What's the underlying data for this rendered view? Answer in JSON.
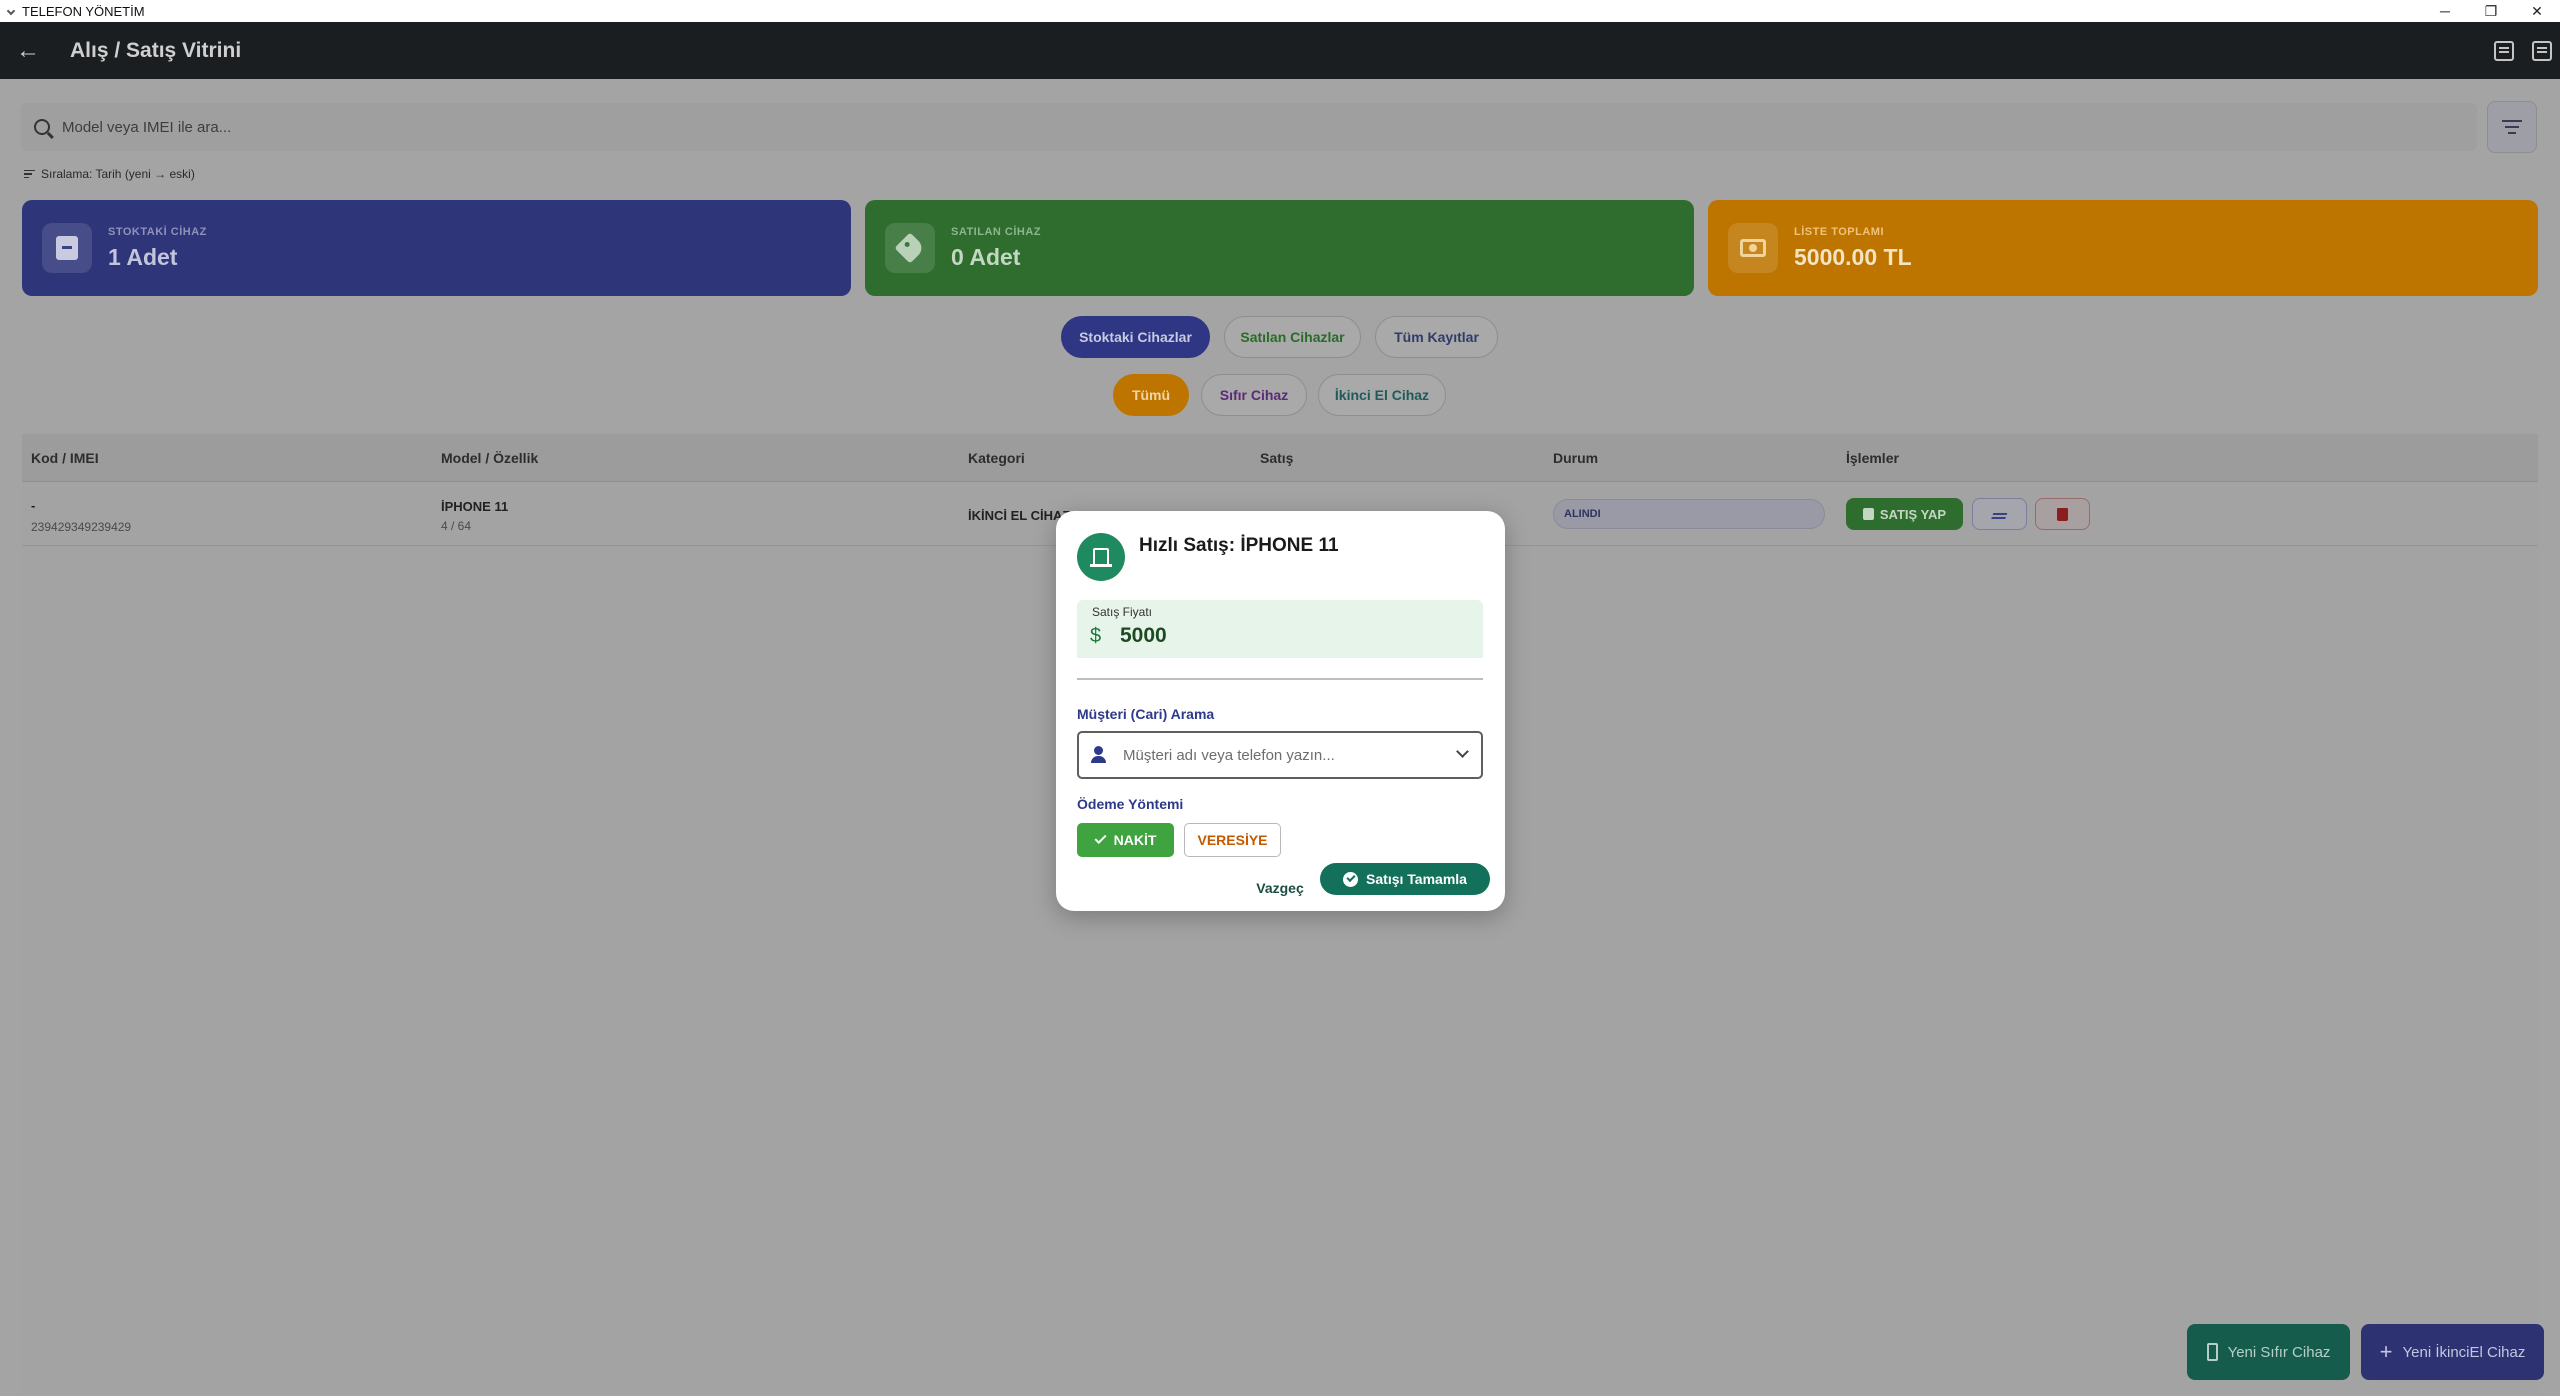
{
  "window": {
    "title": "TELEFON YÖNETİM",
    "controls": {
      "minimize": "─",
      "restore": "❐",
      "close": "✕"
    }
  },
  "appbar": {
    "back_icon": "arrow-left-icon",
    "title": "Alış / Satış Vitrini",
    "actions": [
      "image-icon",
      "table-icon"
    ]
  },
  "search": {
    "placeholder": "Model veya IMEI ile ara..."
  },
  "sort_info": "Sıralama: Tarih (yeni → eski)",
  "stats": [
    {
      "label": "STOKTAKİ CİHAZ",
      "value": "1 Adet",
      "icon": "archive-icon",
      "color": "#2e3579"
    },
    {
      "label": "SATILAN CİHAZ",
      "value": "0 Adet",
      "icon": "tag-icon",
      "color": "#2f6d2f"
    },
    {
      "label": "LİSTE TOPLAMI",
      "value": "5000.00 TL",
      "icon": "cash-icon",
      "color": "#bd7500"
    }
  ],
  "filters": {
    "status": [
      "Stoktaki Cihazlar",
      "Satılan Cihazlar",
      "Tüm Kayıtlar"
    ],
    "status_selected": "Stoktaki Cihazlar",
    "type": [
      "Tümü",
      "Sıfır Cihaz",
      "İkinci El Cihaz"
    ],
    "type_selected": "Tümü"
  },
  "table": {
    "headers": [
      "Kod / IMEI",
      "Model / Özellik",
      "Kategori",
      "Satış",
      "Durum",
      "İşlemler"
    ],
    "rows": [
      {
        "code": "-",
        "imei": "239429349239429",
        "model": "İPHONE 11",
        "spec": "4 / 64",
        "category": "İKİNCİ EL CİHAZ",
        "status": "ALINDI",
        "sell_label": "SATIŞ YAP"
      }
    ]
  },
  "fabs": {
    "new_zero": "Yeni Sıfır Cihaz",
    "new_second": "Yeni İkinciEl Cihaz"
  },
  "dialog": {
    "title": "Hızlı Satış: İPHONE 11",
    "price_label": "Satış Fiyatı",
    "currency_symbol": "$",
    "price_value": "5000",
    "customer_label": "Müşteri (Cari) Arama",
    "customer_placeholder": "Müşteri adı veya telefon yazın...",
    "payment_label": "Ödeme Yöntemi",
    "payment_options": [
      "NAKİT",
      "VERESİYE"
    ],
    "payment_selected": "NAKİT",
    "cancel_label": "Vazgeç",
    "confirm_label": "Satışı Tamamla"
  },
  "colors": {
    "accent_green": "#13705a",
    "cash_green": "#3fa33f",
    "credit_orange": "#c35a00",
    "section_blue": "#2d3a8a"
  }
}
